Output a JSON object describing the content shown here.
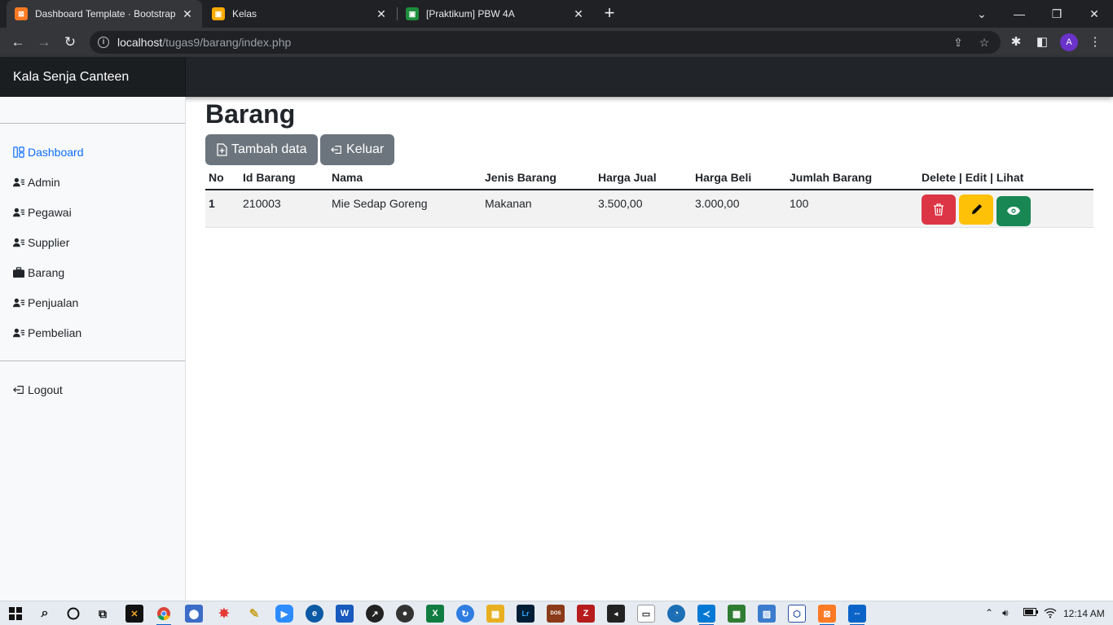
{
  "browser": {
    "tabs": [
      {
        "title": "Dashboard Template · Bootstrap",
        "favicon": "xampp-icon",
        "color": "#fb7a24"
      },
      {
        "title": "Kelas",
        "favicon": "classroom-icon",
        "color": "#f9ab00"
      },
      {
        "title": "[Praktikum] PBW 4A",
        "favicon": "classroom-icon",
        "color": "#1e8e3e"
      }
    ],
    "url_host": "localhost",
    "url_path": "/tugas9/barang/index.php",
    "profile_initial": "A"
  },
  "app": {
    "brand": "Kala Senja Canteen",
    "accent": "#0d6efd"
  },
  "sidebar": {
    "items": [
      {
        "label": "Dashboard",
        "icon": "layout-icon"
      },
      {
        "label": "Admin",
        "icon": "person-lines-icon"
      },
      {
        "label": "Pegawai",
        "icon": "person-lines-icon"
      },
      {
        "label": "Supplier",
        "icon": "person-lines-icon"
      },
      {
        "label": "Barang",
        "icon": "briefcase-icon"
      },
      {
        "label": "Penjualan",
        "icon": "person-lines-icon"
      },
      {
        "label": "Pembelian",
        "icon": "person-lines-icon"
      }
    ],
    "logout": {
      "label": "Logout",
      "icon": "box-arrow-left-icon"
    }
  },
  "main": {
    "title": "Barang",
    "add_button": "Tambah data",
    "exit_button": "Keluar",
    "table": {
      "headers": [
        "No",
        "Id Barang",
        "Nama",
        "Jenis Barang",
        "Harga Jual",
        "Harga Beli",
        "Jumlah Barang",
        "Delete | Edit | Lihat"
      ],
      "rows": [
        {
          "no": "1",
          "id": "210003",
          "nama": "Mie Sedap Goreng",
          "jenis": "Makanan",
          "harga_jual": "3.500,00",
          "harga_beli": "3.000,00",
          "jumlah": "100"
        }
      ]
    },
    "action_colors": {
      "delete": "#dc3545",
      "edit": "#ffc107",
      "view": "#198754"
    }
  },
  "taskbar": {
    "clock": "12:14 AM"
  }
}
